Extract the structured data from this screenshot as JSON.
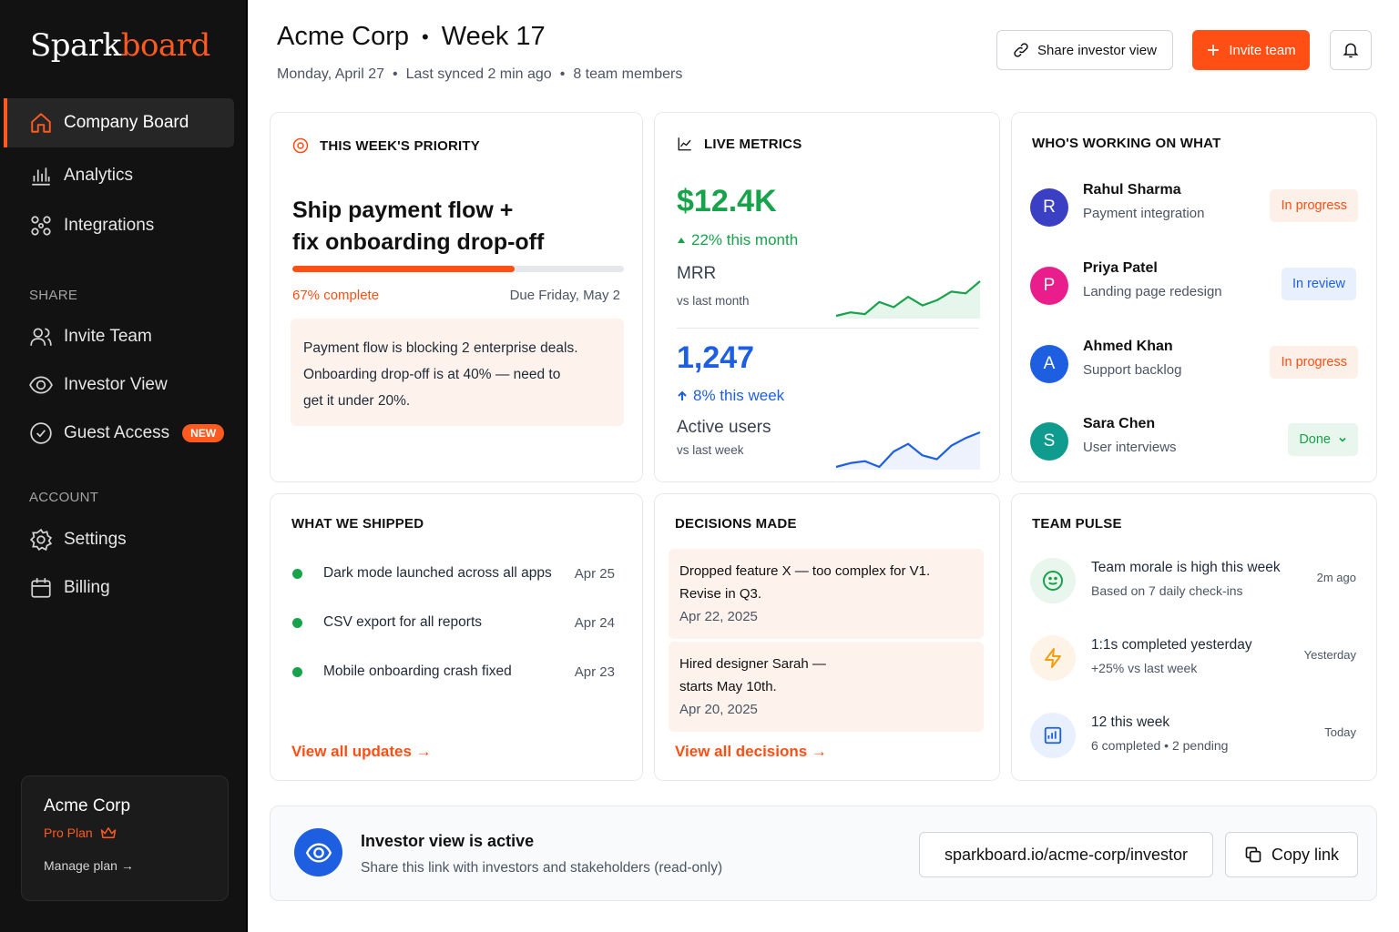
{
  "sidebar": {
    "logo_part1": "Spark",
    "logo_part2": "board",
    "nav_main": [
      {
        "label": "Company Board",
        "icon": "home-icon",
        "active": true
      },
      {
        "label": "Analytics",
        "icon": "bar-chart-icon"
      },
      {
        "label": "Integrations",
        "icon": "integrations-icon"
      }
    ],
    "share_heading": "SHARE",
    "nav_share": [
      {
        "label": "Invite Team",
        "icon": "users-icon"
      },
      {
        "label": "Investor View",
        "icon": "eye-icon"
      },
      {
        "label": "Guest Access",
        "icon": "guest-icon",
        "badge": "NEW"
      }
    ],
    "account_heading": "ACCOUNT",
    "nav_account": [
      {
        "label": "Settings",
        "icon": "gear-icon"
      },
      {
        "label": "Billing",
        "icon": "calendar-icon"
      }
    ],
    "plan_card": {
      "company": "Acme Corp",
      "plan": "Pro Plan",
      "manage": "Manage plan →"
    }
  },
  "header": {
    "company": "Acme Corp",
    "separator": "•",
    "week": "Week 17",
    "date": "Monday, April 27",
    "sync": "Last synced 2 min ago",
    "members": "8 team members",
    "dot": "•",
    "share_button": "Share investor view",
    "invite_button": "Invite team"
  },
  "priority": {
    "title": "THIS WEEK'S PRIORITY",
    "heading_line1": "Ship payment flow +",
    "heading_line2": "fix onboarding drop-off",
    "progress": 0.67,
    "progress_label": "67% complete",
    "due": "Due Friday, May 2",
    "note_line1": "Payment flow is blocking 2 enterprise deals.",
    "note_line2": "Onboarding drop-off is at 40% — need to",
    "note_line3": "get it under 20%."
  },
  "metrics": {
    "title": "LIVE METRICS",
    "mrr": {
      "value": "$12.4K",
      "change": "22% this month",
      "label": "MRR",
      "sub": "vs last month",
      "trend": [
        2,
        3,
        2.5,
        6,
        4.5,
        7.5,
        5,
        6.5,
        9,
        8.5,
        12
      ]
    },
    "users": {
      "value": "1,247",
      "change": "8% this week",
      "label": "Active users",
      "sub": "vs last week",
      "trend": [
        2,
        3,
        3.5,
        2,
        6,
        8,
        5,
        4,
        7.5,
        9.5,
        11
      ]
    },
    "colors": {
      "green": "#16a34a",
      "blue": "#1d5fe0"
    }
  },
  "team": {
    "title": "WHO'S WORKING ON WHAT",
    "people": [
      {
        "initial": "R",
        "name": "Rahul Sharma",
        "role": "Payment integration",
        "status": "In progress",
        "color": "#3b3fc4"
      },
      {
        "initial": "P",
        "name": "Priya Patel",
        "role": "Landing page redesign",
        "status": "In review",
        "color": "#e91e8c"
      },
      {
        "initial": "A",
        "name": "Ahmed Khan",
        "role": "Support backlog",
        "status": "In progress",
        "color": "#1d5fe0"
      },
      {
        "initial": "S",
        "name": "Sara Chen",
        "role": "User interviews",
        "status": "Done",
        "color": "#0f9b8e"
      }
    ]
  },
  "shipped": {
    "title": "WHAT WE SHIPPED",
    "items": [
      {
        "text": "Dark mode launched across all apps",
        "date": "Apr 25"
      },
      {
        "text": "CSV export for all reports",
        "date": "Apr 24"
      },
      {
        "text": "Mobile onboarding crash fixed",
        "date": "Apr 23"
      }
    ],
    "link": "View all updates →"
  },
  "decisions": {
    "title": "DECISIONS MADE",
    "items": [
      {
        "line1": "Dropped feature X — too complex for V1.",
        "line2": "Revise in Q3.",
        "date": "Apr 22, 2025"
      },
      {
        "line1": "Hired designer Sarah —",
        "line2": "starts May 10th.",
        "date": "Apr 20, 2025"
      }
    ],
    "link": "View all decisions →"
  },
  "pulse": {
    "title": "TEAM PULSE",
    "items": [
      {
        "title": "Team morale is high this week",
        "sub": "Based on 7 daily check-ins",
        "time": "2m ago"
      },
      {
        "title": "1:1s completed yesterday",
        "sub": "+25% vs last week",
        "time": "Yesterday"
      },
      {
        "title": "12 this week",
        "sub": "6 completed • 2 pending",
        "time": "Today"
      }
    ]
  },
  "investor_bar": {
    "title": "Investor view is active",
    "subtitle": "Share this link with investors and stakeholders (read-only)",
    "url": "sparkboard.io/acme-corp/investor",
    "copy": "Copy link"
  }
}
